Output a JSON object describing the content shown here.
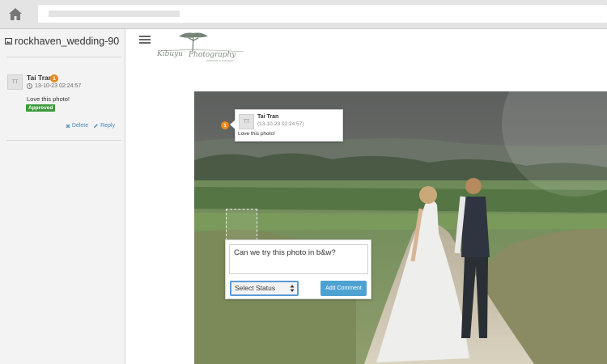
{
  "browser": {
    "home_icon": "home-icon",
    "url": ""
  },
  "sidebar": {
    "title": "rockhaven_wedding-90",
    "title_icon": "image-icon",
    "comment": {
      "initials": "TT",
      "author": "Tai Tran",
      "badge": "1",
      "timestamp": "13-10-23 02:24:57",
      "text": "Love this photo!",
      "status": "Approved",
      "delete_label": "Delete",
      "reply_label": "Reply"
    }
  },
  "main": {
    "menu_icon": "hamburger-icon",
    "logo_text": "Kibuyu Photography",
    "tooltip": {
      "initials": "TT",
      "badge": "1",
      "author": "Tai Tran",
      "timestamp": "(13-10-23 02:24:57)",
      "text": "Love this photo!"
    },
    "comment_form": {
      "value": "Can we try this photo in b&w?",
      "select_value": "Select Status",
      "submit_label": "Add Comment"
    }
  },
  "colors": {
    "badge": "#e8891d",
    "approved": "#3c9a3c",
    "link": "#4a8bc2",
    "button": "#4ea2d2",
    "select_border": "#5b9ad9"
  }
}
